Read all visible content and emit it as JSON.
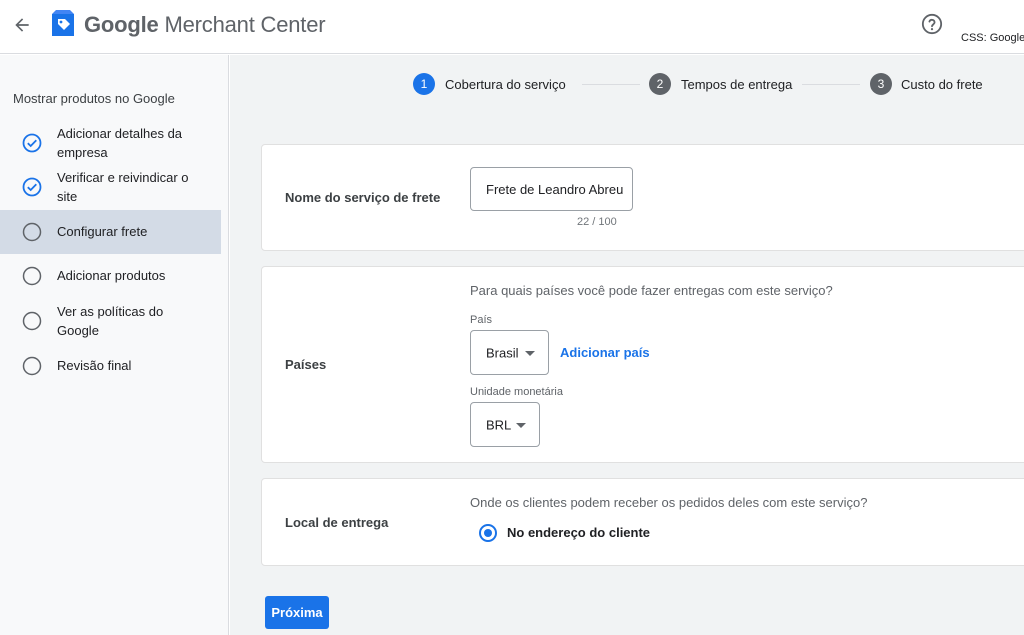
{
  "header": {
    "brand_google": "Google",
    "brand_product": "Merchant Center",
    "css_label": "CSS: Google"
  },
  "sidebar": {
    "title": "Mostrar produtos no Google",
    "items": [
      {
        "label": "Adicionar detalhes da empresa",
        "status": "done"
      },
      {
        "label": "Verificar e reivindicar o site",
        "status": "done"
      },
      {
        "label": "Configurar frete",
        "status": "current"
      },
      {
        "label": "Adicionar produtos",
        "status": "todo"
      },
      {
        "label": "Ver as políticas do Google",
        "status": "todo"
      },
      {
        "label": "Revisão final",
        "status": "todo"
      }
    ]
  },
  "stepper": {
    "steps": [
      {
        "num": "1",
        "label": "Cobertura do serviço",
        "active": true
      },
      {
        "num": "2",
        "label": "Tempos de entrega",
        "active": false
      },
      {
        "num": "3",
        "label": "Custo do frete",
        "active": false
      }
    ]
  },
  "service_name": {
    "label": "Nome do serviço de frete",
    "value": "Frete de Leandro Abreu",
    "counter": "22 / 100"
  },
  "countries": {
    "label": "Países",
    "question": "Para quais países você pode fazer entregas com este serviço?",
    "country_label": "País",
    "country_value": "Brasil",
    "add_country": "Adicionar país",
    "currency_label": "Unidade monetária",
    "currency_value": "BRL"
  },
  "delivery": {
    "label": "Local de entrega",
    "question": "Onde os clientes podem receber os pedidos deles com este serviço?",
    "option": "No endereço do cliente"
  },
  "next_button": "Próxima",
  "colors": {
    "accent": "#1a73e8",
    "step_inactive": "#5f6368",
    "sidebar_active": "#d3dbe6"
  },
  "icons": [
    "back-arrow-icon",
    "merchant-center-logo-icon",
    "help-circle-icon",
    "check-circle-icon",
    "empty-circle-icon",
    "radio-selected-icon",
    "dropdown-caret-icon"
  ]
}
